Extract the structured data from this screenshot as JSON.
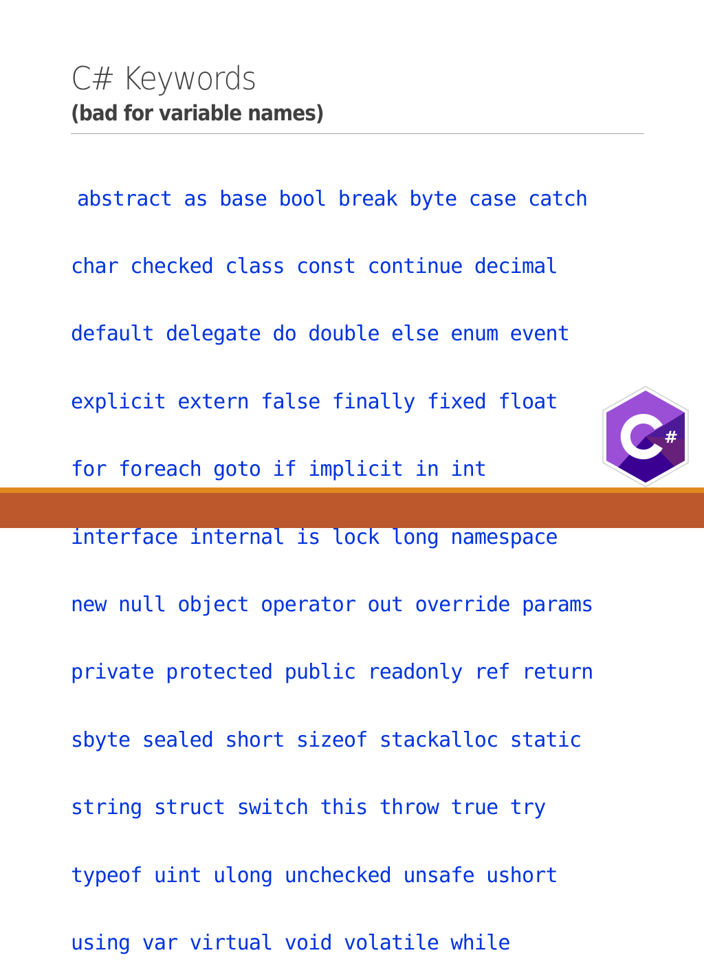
{
  "slide": {
    "title": "C# Keywords",
    "subtitle": "(bad for variable names)",
    "keyword_lines": [
      "abstract as base bool break byte case catch",
      "char checked class const continue decimal",
      "default delegate do double else enum event",
      "explicit extern false finally fixed float",
      "for foreach goto if implicit in int",
      "interface internal is lock long namespace",
      "new null object operator out override params",
      "private protected public readonly ref return",
      "sbyte sealed short sizeof stackalloc static",
      "string struct switch this throw true try",
      "typeof uint ulong unchecked unsafe ushort",
      "using var virtual void volatile while"
    ],
    "logo": {
      "icon": "csharp-logo-icon",
      "letter": "C",
      "symbol": "#"
    }
  },
  "colors": {
    "title": "#404040",
    "keywords": "#0033dd",
    "divider": "#a6a6a6",
    "logo_light": "#9b4fd6",
    "logo_mid": "#68217a",
    "logo_dark": "#390091",
    "footer_stripe": "#e08a1e",
    "footer_band": "#bc582c"
  }
}
